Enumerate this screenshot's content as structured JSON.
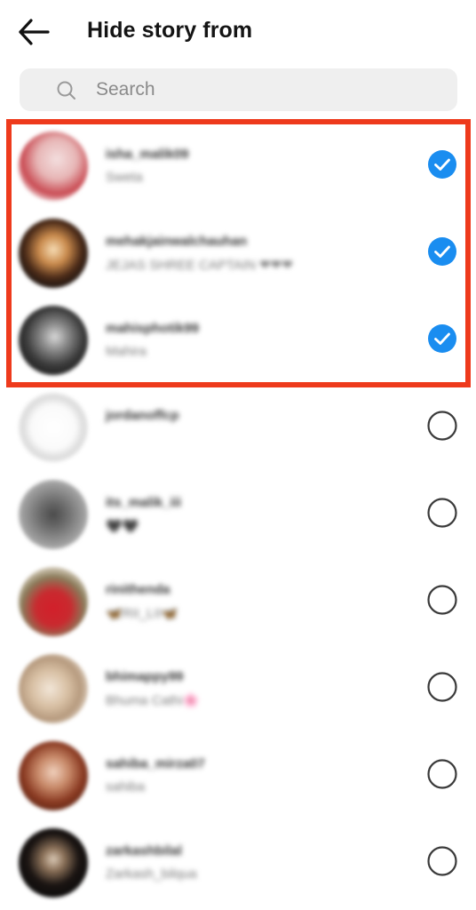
{
  "header": {
    "title": "Hide story from",
    "back_icon": "arrow-left-icon"
  },
  "search": {
    "placeholder": "Search",
    "value": "",
    "icon": "search-icon"
  },
  "colors": {
    "checked": "#1a8df0",
    "unchecked_border": "#3a3a3a",
    "highlight": "#ee3a1c",
    "search_bg": "#efefef"
  },
  "users": [
    {
      "username": "isha_malik09",
      "fullname": "Sweta",
      "selected": true
    },
    {
      "username": "mehakjainwalchauhan",
      "fullname": "JEJAS SHREE CAPTAIN ❤❤❤",
      "selected": true
    },
    {
      "username": "mahisphotik99",
      "fullname": "Mahira",
      "selected": true
    },
    {
      "username": "jordanoffcp",
      "fullname": "",
      "selected": false
    },
    {
      "username": "its_malik_iii",
      "fullname": "🖤🖤",
      "selected": false
    },
    {
      "username": "rinithenda",
      "fullname": "🦋RII_LII🦋",
      "selected": false
    },
    {
      "username": "bhimappy99",
      "fullname": "Bhuma Cathi🌸",
      "selected": false
    },
    {
      "username": "sahiba_mirza07",
      "fullname": "sahiba",
      "selected": false
    },
    {
      "username": "zarkashbilal",
      "fullname": "Zarkash_bilqua",
      "selected": false
    }
  ]
}
